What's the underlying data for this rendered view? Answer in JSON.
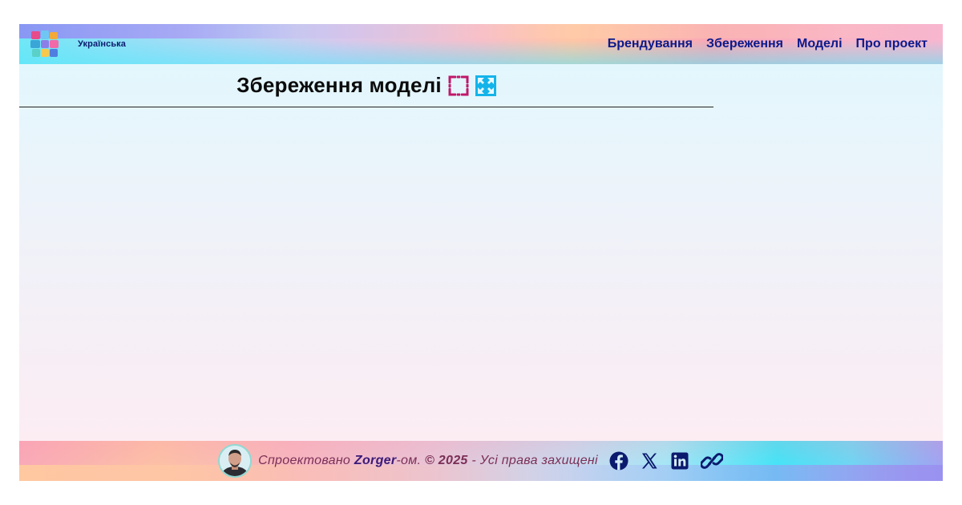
{
  "header": {
    "language_label": "Українська",
    "nav": [
      {
        "label": "Брендування"
      },
      {
        "label": "Збереження"
      },
      {
        "label": "Моделі"
      },
      {
        "label": "Про проект"
      }
    ]
  },
  "main": {
    "title": "Збереження моделі",
    "fullscreen_icon": "fullscreen-corners-icon",
    "expand_icon": "expand-arrows-icon"
  },
  "footer": {
    "prefix": "Спроектовано",
    "author": "Zorger",
    "suffix": "-ом.",
    "copyright": "© 2025",
    "rights": "- Усі права захищені",
    "socials": [
      {
        "icon": "facebook-icon"
      },
      {
        "icon": "x-icon"
      },
      {
        "icon": "linkedin-icon"
      },
      {
        "icon": "link-icon"
      }
    ]
  },
  "colors": {
    "nav_text": "#0b1a8a",
    "title_text": "#0b0b0b",
    "fullscreen_icon": "#c0186a",
    "expand_icon": "#14b4ea",
    "footer_text": "#7b2f55",
    "footer_name": "#3a1a78",
    "social_icons": "#0b1a6e"
  }
}
